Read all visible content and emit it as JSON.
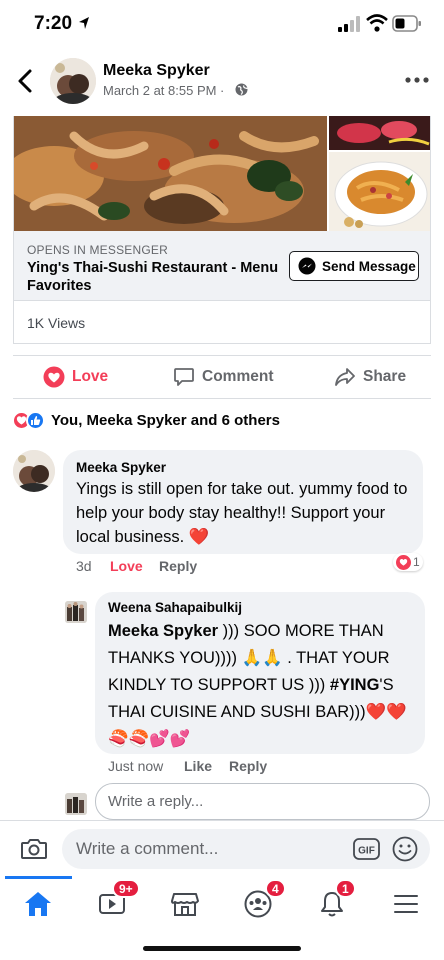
{
  "status_bar": {
    "time": "7:20"
  },
  "header": {
    "name": "Meeka Spyker",
    "date": "March 2 at 8:55 PM ·"
  },
  "link_preview": {
    "caption": "OPENS IN MESSENGER",
    "title": "Ying's Thai-Sushi Restaurant - Menu Favorites",
    "button_label": "Send Message",
    "views": "1K Views"
  },
  "actions": {
    "love": "Love",
    "comment": "Comment",
    "share": "Share"
  },
  "reactions_summary": "You, Meeka Spyker and 6 others",
  "comments": [
    {
      "author": "Meeka Spyker",
      "text": "Yings is still open for take out. yummy food to help your body stay healthy!!   Support your local business. ❤️",
      "time": "3d",
      "love": "Love",
      "reply": "Reply",
      "reaction_count": "1"
    },
    {
      "author": "Weena Sahapaibulkij",
      "mention": "Meeka Spyker",
      "text_part1": " )))  SOO MORE THAN THANKS YOU)))) 🙏🙏 . THAT YOUR KINDLY TO SUPPORT US )))  ",
      "hashtag": "#YING",
      "text_part2": "'S THAI CUISINE AND SUSHI BAR)))❤️❤️🍣🍣💕💕",
      "time": "Just now",
      "like": "Like",
      "reply": "Reply"
    }
  ],
  "reply_placeholder": "Write a reply...",
  "comment_placeholder": "Write a comment...",
  "tabs": {
    "watch_badge": "9+",
    "groups_badge": "4",
    "notifications_badge": "1"
  },
  "colors": {
    "accent": "#1877f2",
    "love": "#f33e58",
    "badge": "#e41e3f"
  }
}
